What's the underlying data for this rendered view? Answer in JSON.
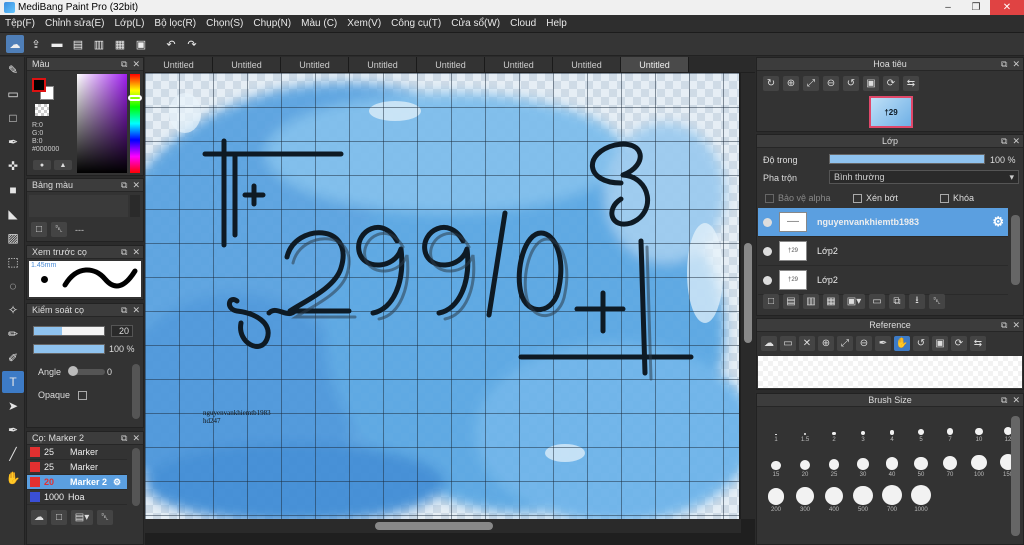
{
  "window": {
    "title": "MediBang Paint Pro (32bit)"
  },
  "menu": [
    "Tệp(F)",
    "Chỉnh sửa(E)",
    "Lớp(L)",
    "Bộ lọc(R)",
    "Chọn(S)",
    "Chụp(N)",
    "Màu (C)",
    "Xem(V)",
    "Công cụ(T)",
    "Cửa sổ(W)",
    "Cloud",
    "Help"
  ],
  "color_panel": {
    "title": "Màu",
    "r": "R:0",
    "g": "G:0",
    "b": "B:0",
    "hex": "#000000",
    "fg": "#000000",
    "bg": "#ffffff"
  },
  "palette_panel": {
    "title": "Bảng màu",
    "dash": "---"
  },
  "preview_panel": {
    "title": "Xem trước cọ",
    "size": "1.45mm"
  },
  "control_panel": {
    "title": "Kiểm soát cọ",
    "size_value": "20",
    "size_fraction": 0.4,
    "opacity_value": "100 %",
    "opacity_fraction": 1.0,
    "angle_label": "Angle",
    "angle_value": "0",
    "opaque_label": "Opaque"
  },
  "brush_panel": {
    "title": "Cọ: Marker 2",
    "items": [
      {
        "size": "25",
        "name": "Marker",
        "color": "#e23030"
      },
      {
        "size": "25",
        "name": "Marker",
        "color": "#e23030"
      },
      {
        "size": "20",
        "name": "Marker 2",
        "color": "#e23030"
      },
      {
        "size": "1000",
        "name": "Hoa",
        "color": "#3a4fd8"
      }
    ]
  },
  "tabs": [
    "Untitled",
    "Untitled",
    "Untitled",
    "Untitled",
    "Untitled",
    "Untitled",
    "Untitled",
    "Untitled"
  ],
  "canvas": {
    "caption_line1": "nguyenvankhiemtb1983",
    "caption_line2": "hd247"
  },
  "navigator": {
    "title": "Hoa tiêu"
  },
  "layer_panel": {
    "title": "Lớp",
    "opacity_label": "Độ trong",
    "opacity_value": "100 %",
    "blend_label": "Pha trộn",
    "blend_value": "Bình thường",
    "protect_alpha": "Bảo vệ alpha",
    "clipping": "Xén bớt",
    "lock": "Khóa",
    "layers": [
      {
        "name": "nguyenvankhiemtb1983"
      },
      {
        "name": "Lớp2"
      },
      {
        "name": "Lớp2"
      }
    ]
  },
  "reference_panel": {
    "title": "Reference"
  },
  "brush_size_panel": {
    "title": "Brush Size",
    "sizes": [
      "1",
      "1.5",
      "2",
      "3",
      "4",
      "5",
      "7",
      "10",
      "12",
      "15",
      "20",
      "25",
      "30",
      "40",
      "50",
      "70",
      "100",
      "150",
      "200",
      "300",
      "400",
      "500",
      "700",
      "1000"
    ]
  },
  "icons": {
    "tools": [
      "brush-icon",
      "eraser-icon",
      "rect-select-icon",
      "pen-icon",
      "move-icon",
      "fill-rect-icon",
      "bucket-icon",
      "gradient-icon",
      "marquee-icon",
      "lasso-icon",
      "magic-wand-icon",
      "select-pen-icon",
      "select-eraser-icon",
      "text-icon",
      "operation-icon",
      "eyedropper-icon",
      "divide-icon",
      "hand-icon"
    ]
  }
}
